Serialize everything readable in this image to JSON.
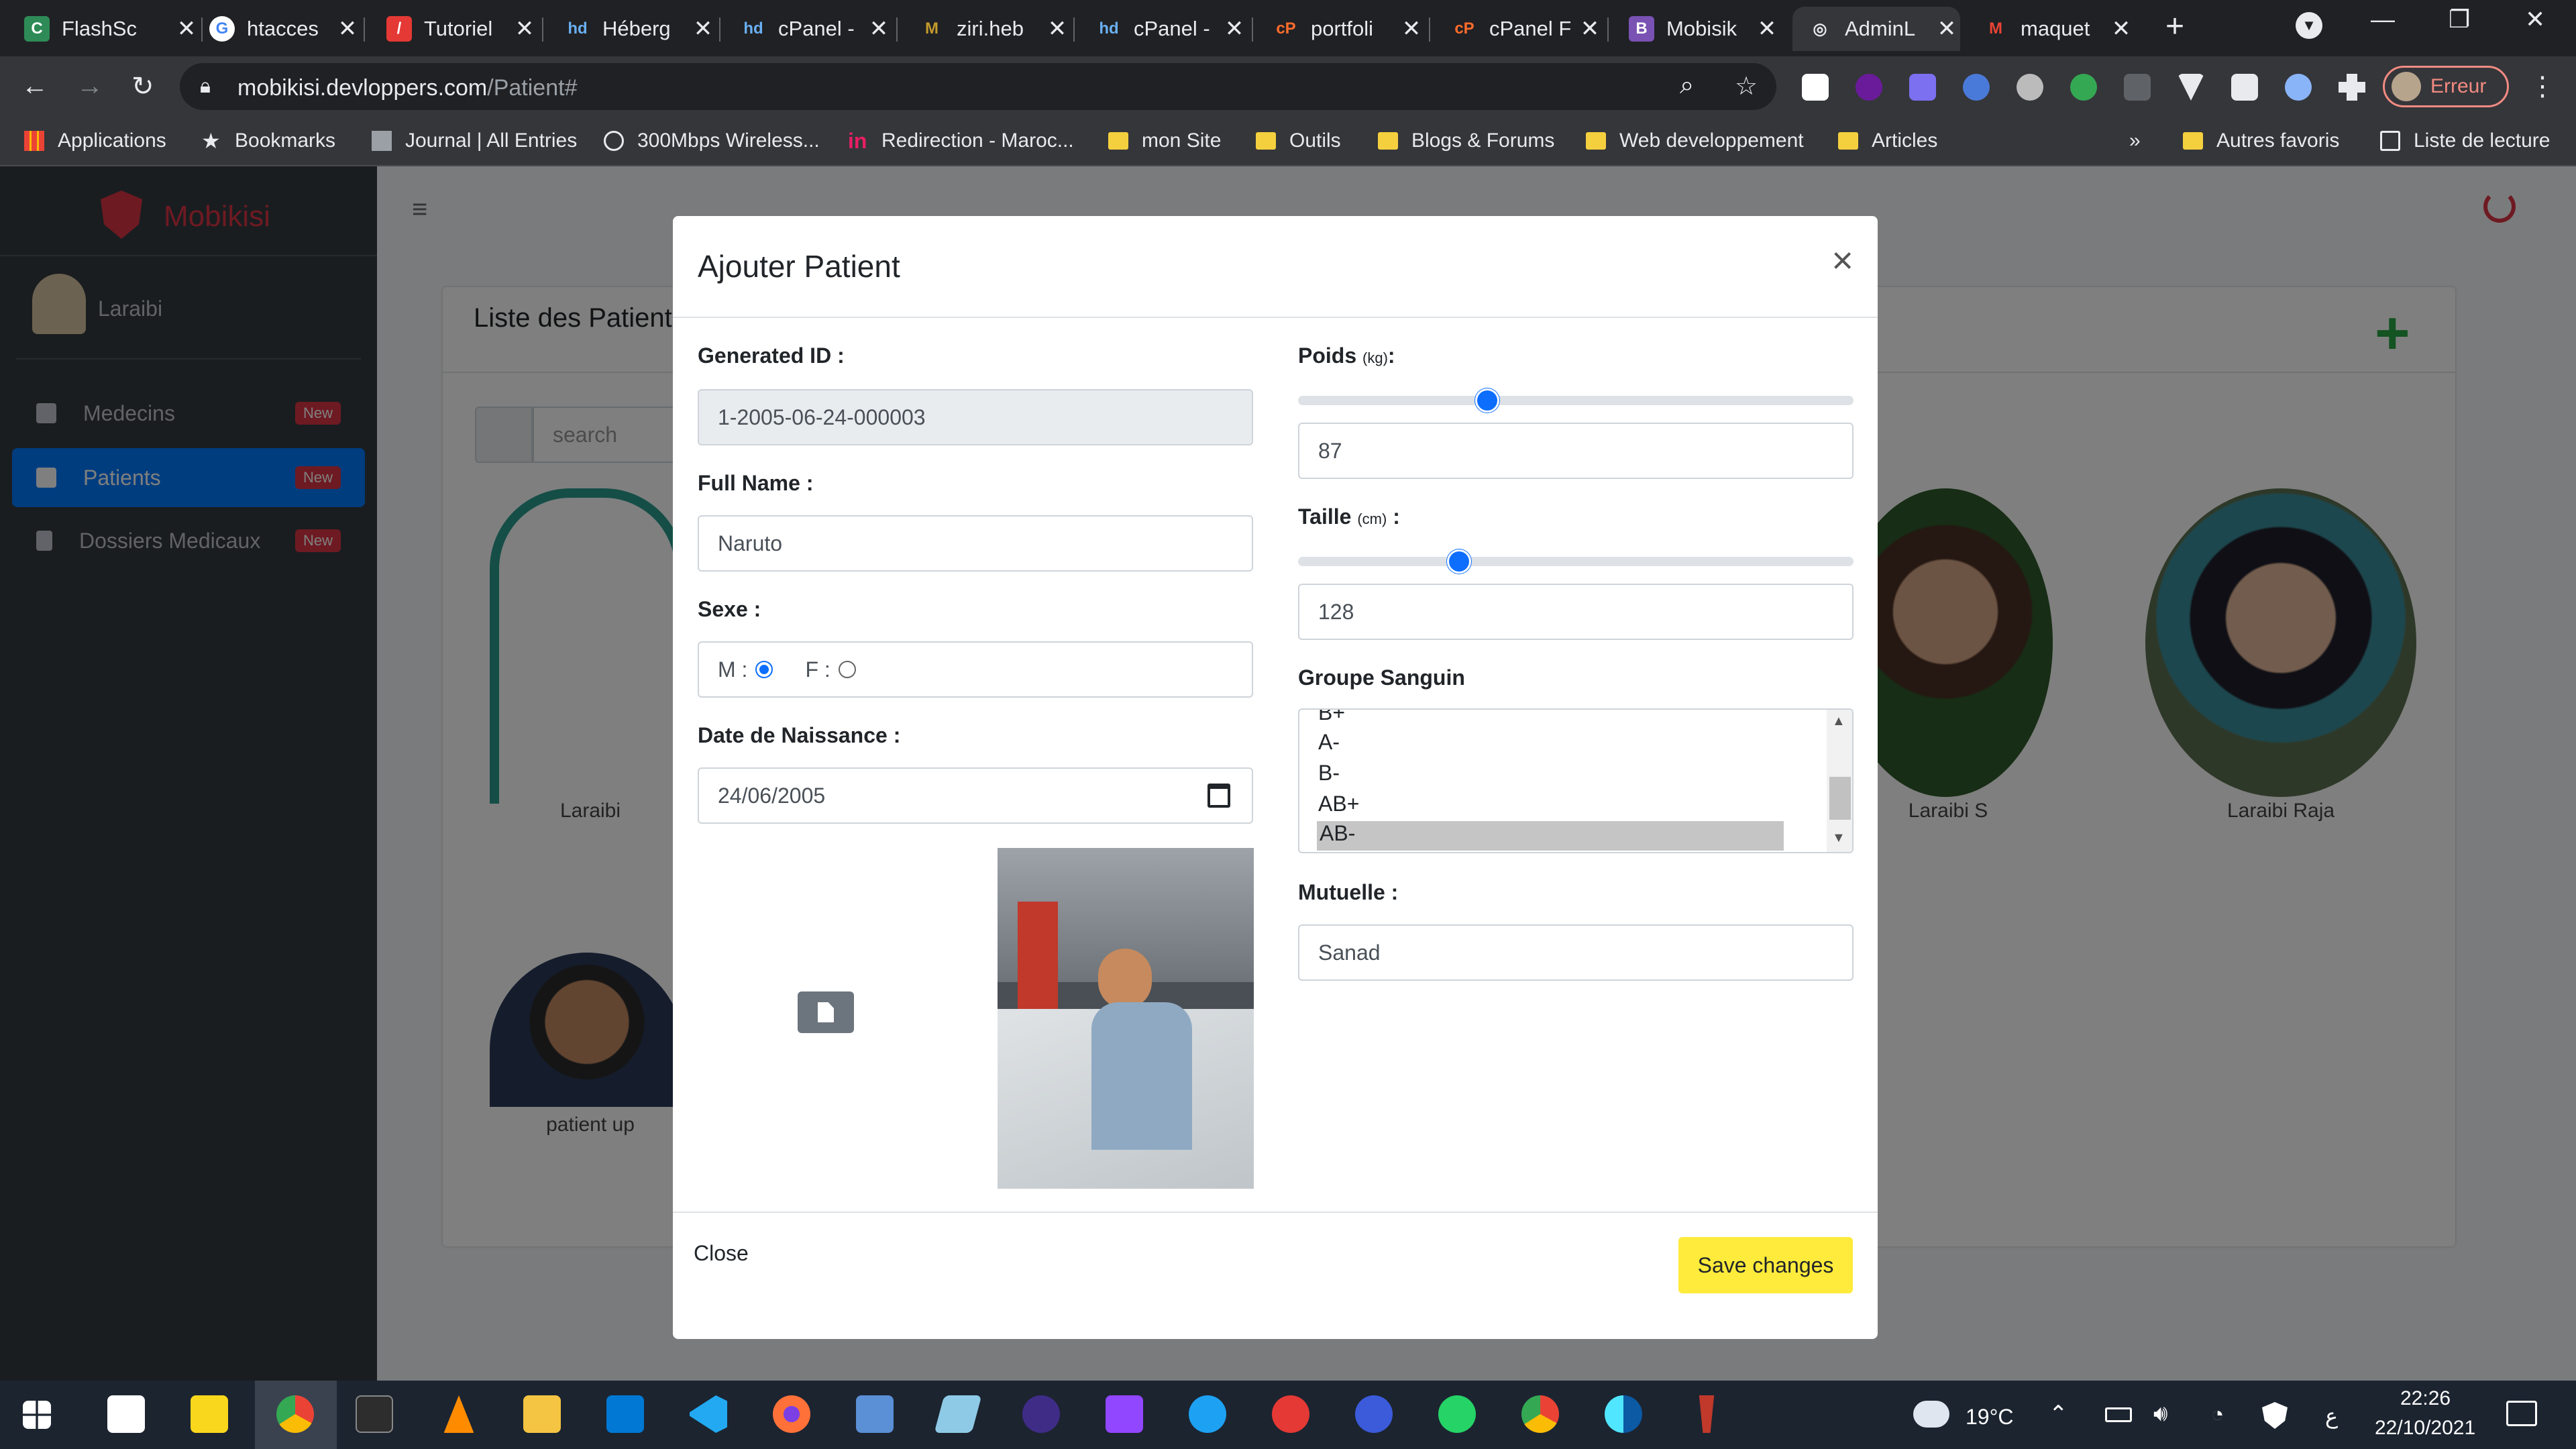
{
  "browser": {
    "tabs": [
      {
        "label": "FlashSc",
        "color": "#2e8b57",
        "glyph": "C"
      },
      {
        "label": "htacces",
        "color": "#4285f4",
        "glyph": "G"
      },
      {
        "label": "Tutoriel",
        "color": "#e53935",
        "glyph": "/"
      },
      {
        "label": "Héberg",
        "color": "#1a73e8",
        "glyph": "hd"
      },
      {
        "label": "cPanel -",
        "color": "#1a73e8",
        "glyph": "hd"
      },
      {
        "label": "ziri.heb",
        "color": "#c49a2c",
        "glyph": "M"
      },
      {
        "label": "cPanel -",
        "color": "#1a73e8",
        "glyph": "hd"
      },
      {
        "label": "portfoli",
        "color": "#ff6c2c",
        "glyph": "cP"
      },
      {
        "label": "cPanel F",
        "color": "#ff6c2c",
        "glyph": "cP"
      },
      {
        "label": "Mobisik",
        "color": "#7952b3",
        "glyph": "B"
      },
      {
        "label": "AdminL",
        "color": "#5f6368",
        "glyph": "◎"
      },
      {
        "label": "maquet",
        "color": "#ea4335",
        "glyph": "M"
      }
    ],
    "new_tab": "+",
    "url_host": "mobikisi.devloppers.com",
    "url_path": "/Patient#",
    "profile_label": "Erreur",
    "bookmarks": [
      {
        "label": "Applications",
        "type": "apps"
      },
      {
        "label": "Bookmarks",
        "type": "star"
      },
      {
        "label": "Journal | All Entries",
        "type": "site"
      },
      {
        "label": "300Mbps Wireless...",
        "type": "globe"
      },
      {
        "label": "Redirection - Maroc...",
        "type": "in"
      },
      {
        "label": "mon Site",
        "type": "folder"
      },
      {
        "label": "Outils",
        "type": "folder"
      },
      {
        "label": "Blogs & Forums",
        "type": "folder"
      },
      {
        "label": "Web developpement",
        "type": "folder"
      },
      {
        "label": "Articles",
        "type": "folder"
      }
    ],
    "bookmarks_more": "»",
    "bookmarks_right": [
      {
        "label": "Autres favoris",
        "type": "folder"
      },
      {
        "label": "Liste de lecture",
        "type": "list"
      }
    ]
  },
  "app": {
    "brand": "Mobikisi",
    "user": "Laraibi",
    "nav": [
      {
        "label": "Medecins",
        "badge": "New"
      },
      {
        "label": "Patients",
        "badge": "New",
        "active": true
      },
      {
        "label": "Dossiers Medicaux",
        "badge": "New"
      }
    ],
    "card_title": "Liste des Patient",
    "search_placeholder": "search",
    "patients": [
      "Laraibi",
      "Laraibi S",
      "Laraibi Raja",
      "patient up"
    ]
  },
  "modal": {
    "title": "Ajouter Patient",
    "close_symbol": "×",
    "generated_id_label": "Generated ID :",
    "generated_id_value": "1-2005-06-24-000003",
    "fullname_label": "Full Name :",
    "fullname_value": "Naruto",
    "sexe_label": "Sexe :",
    "sexe_m": "M :",
    "sexe_f": "F :",
    "sexe_selected": "M",
    "dob_label": "Date de Naissance :",
    "dob_value": "24/06/2005",
    "poids_label": "Poids",
    "poids_unit": "(kg)",
    "poids_value": "87",
    "poids_slider_fraction": 0.34,
    "taille_label": "Taille",
    "taille_unit": "(cm)",
    "taille_value": "128",
    "taille_slider_fraction": 0.29,
    "groupe_label": "Groupe Sanguin",
    "groupe_options": [
      "B+",
      "A-",
      "B-",
      "AB+",
      "AB-"
    ],
    "groupe_selected": "AB-",
    "mutuelle_label": "Mutuelle :",
    "mutuelle_value": "Sanad",
    "close_button": "Close",
    "save_button": "Save changes"
  },
  "taskbar": {
    "weather": "19°C",
    "time": "22:26",
    "date": "22/10/2021",
    "lang": "ع"
  },
  "colors": {
    "primary": "#007bff",
    "save": "#ffeb3b",
    "danger": "#dc3545",
    "add": "#28a745"
  }
}
